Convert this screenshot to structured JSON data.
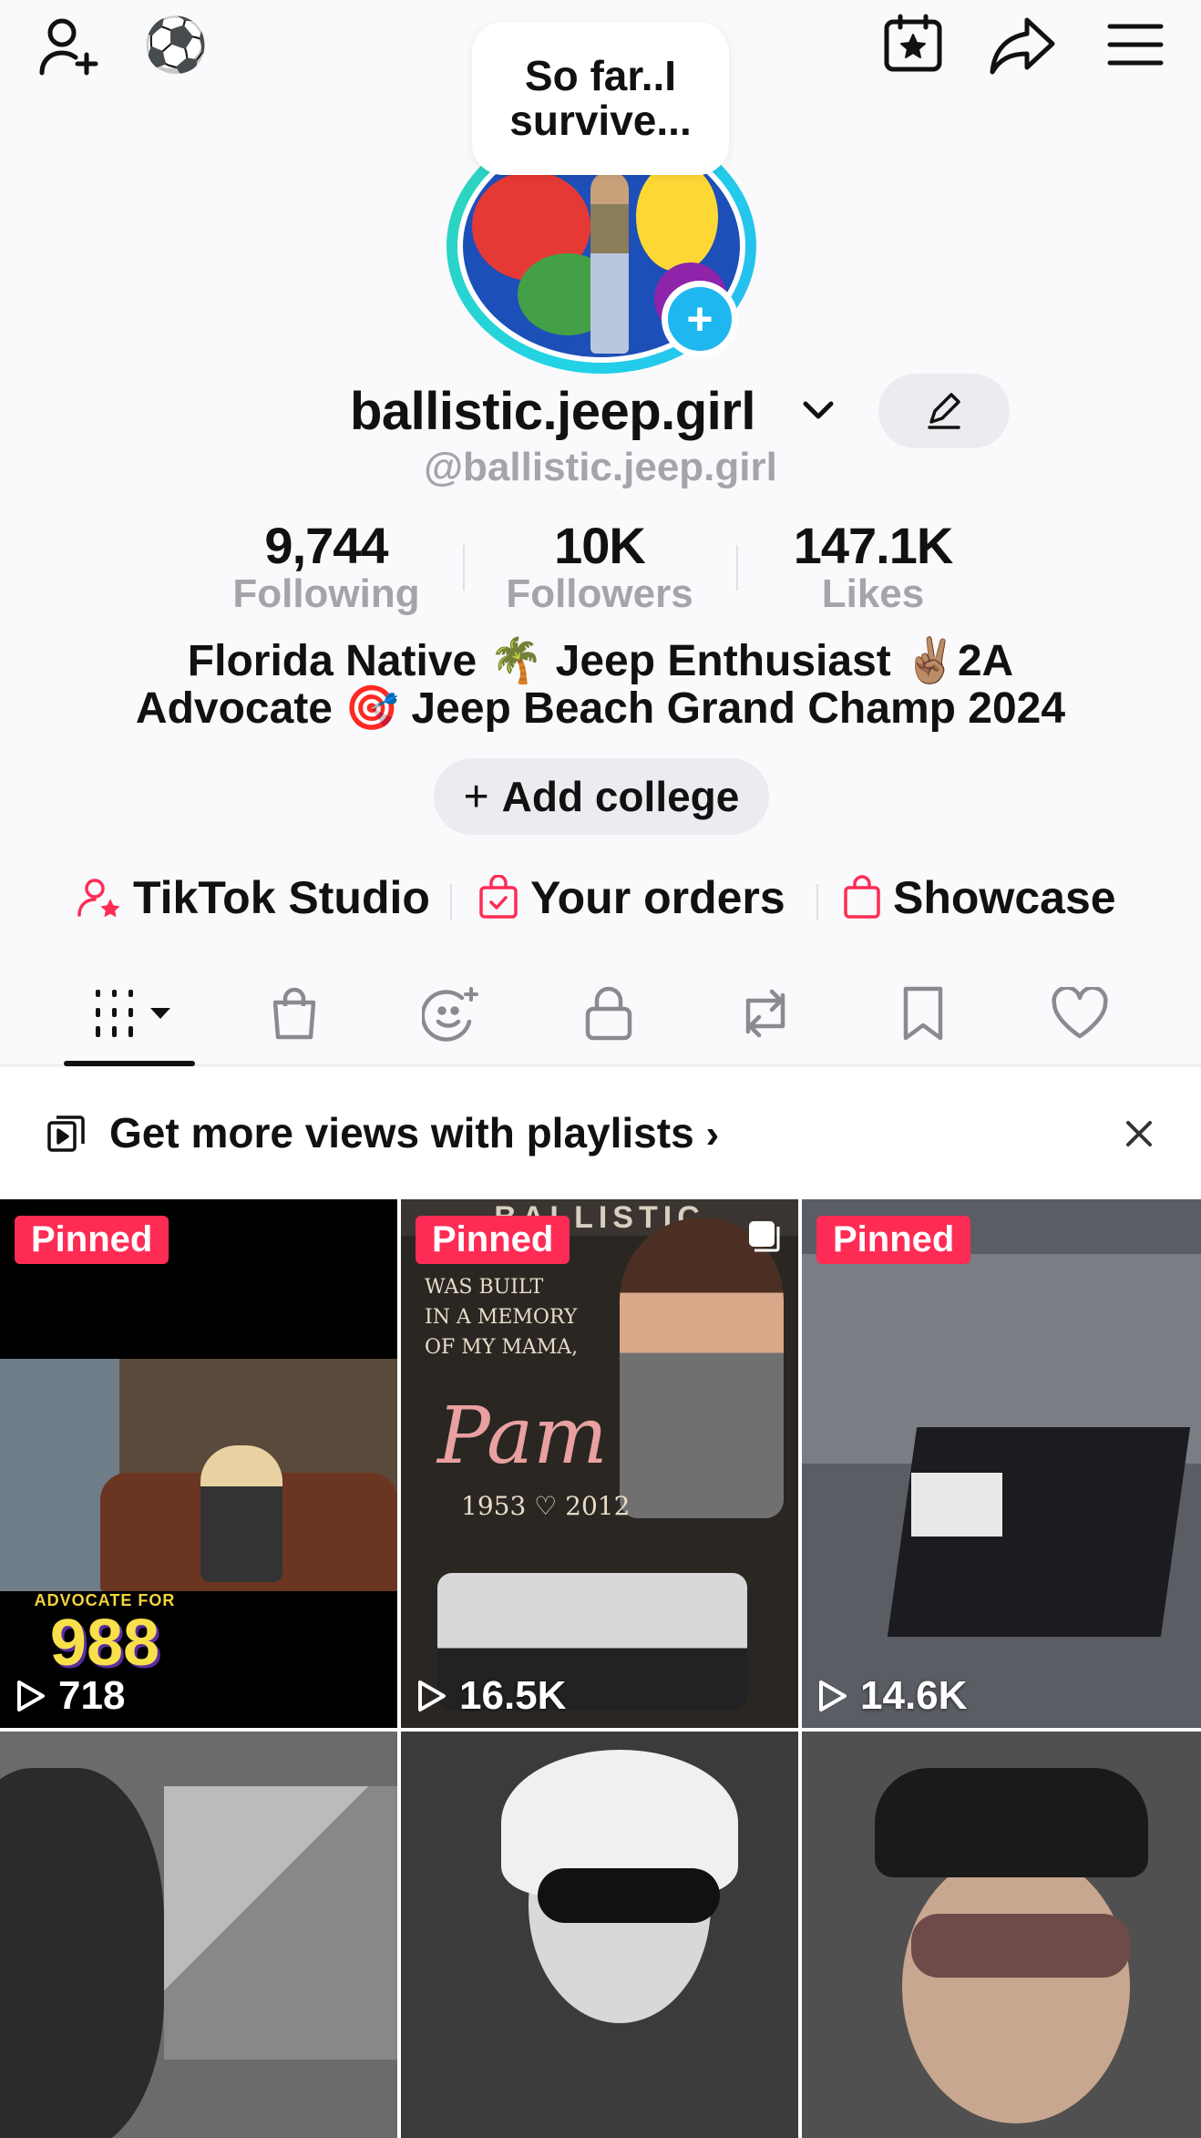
{
  "top_bar": {
    "emoji": "⚽"
  },
  "profile": {
    "status_note": "So far..I survive...",
    "display_name": "ballistic.jeep.girl",
    "handle": "@ballistic.jeep.girl",
    "accent_color": "#22d3e6"
  },
  "stats": {
    "following_count": "9,744",
    "following_label": "Following",
    "followers_count": "10K",
    "followers_label": "Followers",
    "likes_count": "147.1K",
    "likes_label": "Likes"
  },
  "bio": {
    "line1": "Florida Native 🌴 Jeep Enthusiast ✌🏽2A",
    "line2": "Advocate 🎯 Jeep Beach Grand Champ 2024"
  },
  "add_college": {
    "plus": "+",
    "label": "Add college"
  },
  "shortcuts": [
    {
      "label": "TikTok Studio",
      "icon": "person-star-icon"
    },
    {
      "label": "Your orders",
      "icon": "order-bag-icon"
    },
    {
      "label": "Showcase",
      "icon": "shopping-bag-icon"
    }
  ],
  "tabs": [
    {
      "icon": "videos-grid-icon",
      "active": true
    },
    {
      "icon": "shop-bag-icon"
    },
    {
      "icon": "face-sparkle-icon"
    },
    {
      "icon": "lock-icon"
    },
    {
      "icon": "repost-icon"
    },
    {
      "icon": "bookmark-icon"
    },
    {
      "icon": "heart-icon"
    }
  ],
  "playlist_banner": {
    "text": "Get more views with playlists",
    "chevron": "›"
  },
  "videos": [
    {
      "pinned": "Pinned",
      "views": "718",
      "badge_top": "ADVOCATE FOR",
      "badge_num": "988"
    },
    {
      "pinned": "Pinned",
      "views": "16.5K",
      "banner": "BALLISTIC",
      "text_l1": "WAS BUILT",
      "text_l2": "IN A MEMORY",
      "text_l3": "OF MY MAMA,",
      "script_name": "Pam",
      "years": "1953 ♡ 2012"
    },
    {
      "pinned": "Pinned",
      "views": "14.6K"
    },
    {
      "views": ""
    },
    {
      "views": ""
    },
    {
      "views": ""
    }
  ],
  "colors": {
    "pinned_bg": "#fe2c55",
    "avatar_plus": "#1fb7f0"
  }
}
